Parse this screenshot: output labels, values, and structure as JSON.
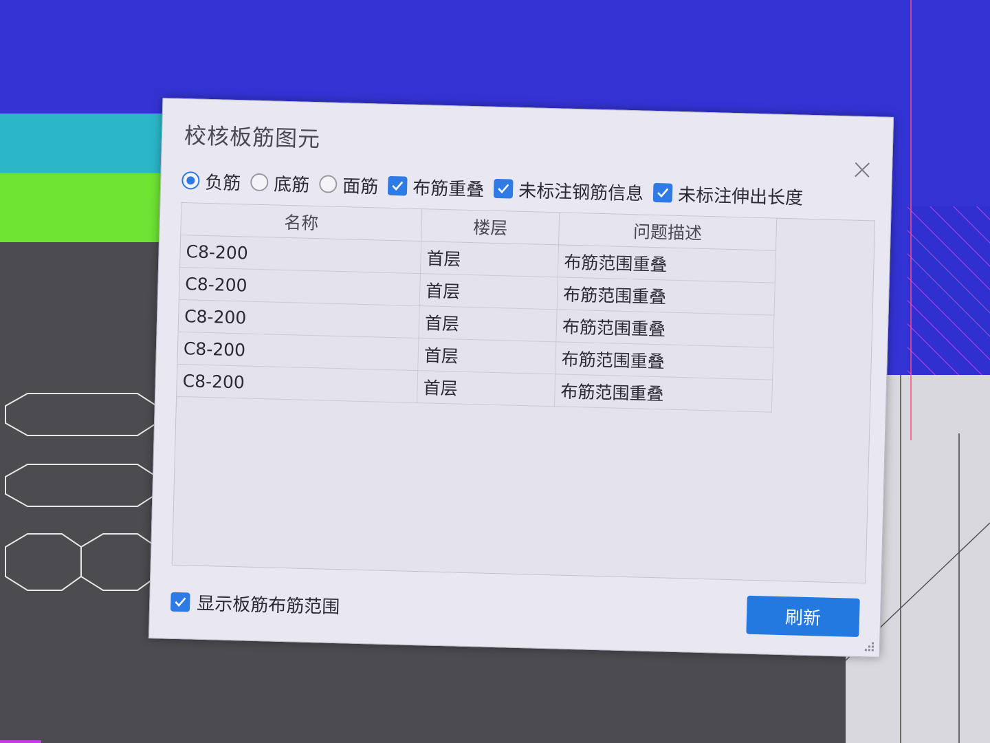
{
  "dialog": {
    "title": "校核板筋图元",
    "rebar_types": [
      {
        "label": "负筋",
        "selected": true
      },
      {
        "label": "底筋",
        "selected": false
      },
      {
        "label": "面筋",
        "selected": false
      }
    ],
    "checks": [
      {
        "label": "布筋重叠",
        "checked": true
      },
      {
        "label": "未标注钢筋信息",
        "checked": true
      },
      {
        "label": "未标注伸出长度",
        "checked": true
      }
    ],
    "table": {
      "headers": [
        "名称",
        "楼层",
        "问题描述"
      ],
      "rows": [
        {
          "name": "C8-200",
          "floor": "首层",
          "desc": "布筋范围重叠"
        },
        {
          "name": "C8-200",
          "floor": "首层",
          "desc": "布筋范围重叠"
        },
        {
          "name": "C8-200",
          "floor": "首层",
          "desc": "布筋范围重叠"
        },
        {
          "name": "C8-200",
          "floor": "首层",
          "desc": "布筋范围重叠"
        },
        {
          "name": "C8-200",
          "floor": "首层",
          "desc": "布筋范围重叠"
        }
      ]
    },
    "show_range": {
      "label": "显示板筋布筋范围",
      "checked": true
    },
    "refresh_label": "刷新"
  },
  "colors": {
    "accent": "#2f7be5",
    "button": "#2479e0",
    "cad_blue": "#3232d6",
    "cad_cyan": "#28c8c8",
    "cad_green": "#6ee832"
  },
  "icons": {
    "close": "close-icon",
    "check": "check-icon",
    "grip": "resize-grip-icon"
  }
}
